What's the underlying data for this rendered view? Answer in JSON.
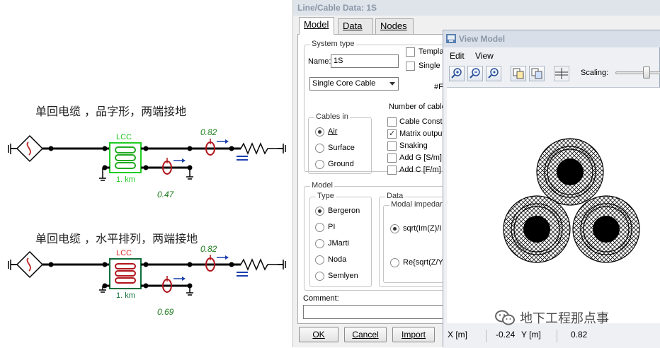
{
  "circuits": {
    "caption_1": "单回电缆 ，品字形，两端接地",
    "caption_2": "单回电缆 ，水平排列，两端接地",
    "value_1a": "0.82",
    "value_1b": "0.47",
    "value_2a": "0.82",
    "value_2b": "0.69",
    "lcc_label": "LCC",
    "length_label": "1. km"
  },
  "dialog": {
    "title": "Line/Cable Data: 1S",
    "tabs": [
      {
        "label": "Model",
        "active": true
      },
      {
        "label": "Data",
        "active": false
      },
      {
        "label": "Nodes",
        "active": false
      }
    ],
    "system_type": {
      "group_title": "System type",
      "name_label": "Name:",
      "name_value": "1S",
      "template_label": "Templa",
      "single_label": "Single p",
      "cable_type": "Single Core Cable",
      "hash_label": "#F",
      "number_of_cables_label": "Number of cable"
    },
    "cables_in": {
      "group_title": "Cables in",
      "options": [
        "Air",
        "Surface",
        "Ground"
      ],
      "selected": "Air"
    },
    "options": [
      {
        "label": "Cable Consta",
        "checked": false
      },
      {
        "label": "Matrix output",
        "checked": true
      },
      {
        "label": "Snaking",
        "checked": false
      },
      {
        "label": "Add G [S/m]",
        "checked": false
      },
      {
        "label": "Add C [F/m]",
        "checked": false
      }
    ],
    "model": {
      "group_title": "Model",
      "type_title": "Type",
      "types": [
        "Bergeron",
        "PI",
        "JMarti",
        "Noda",
        "Semlyen"
      ],
      "selected": "Bergeron",
      "data_title": "Data",
      "modal_title": "Modal impedar",
      "modal_option_1": "sqrt(Im(Z)/I",
      "modal_option_2": "Re{sqrt(Z/Y"
    },
    "comment_label": "Comment:",
    "buttons": {
      "ok": "OK",
      "cancel": "Cancel",
      "import": "Import"
    }
  },
  "view_model": {
    "title": "View Model",
    "menu": [
      "Edit",
      "View"
    ],
    "scaling_label": "Scaling:",
    "scaling_level": 0.72,
    "status": {
      "x_label": "X [m]",
      "x_value": "-0.24",
      "y_label": "Y [m]",
      "y_value": "0.82"
    }
  },
  "watermark": "地下工程那点事",
  "colors": {
    "dialog_bg": "#f0f0f0",
    "title_text": "#8a97a8",
    "green_value": "#1e7d1e",
    "lcc_green": "#1ec81e",
    "lcc_red": "#e0302a",
    "probe_red": "#b0141c",
    "probe_blue": "#1b3fae"
  }
}
